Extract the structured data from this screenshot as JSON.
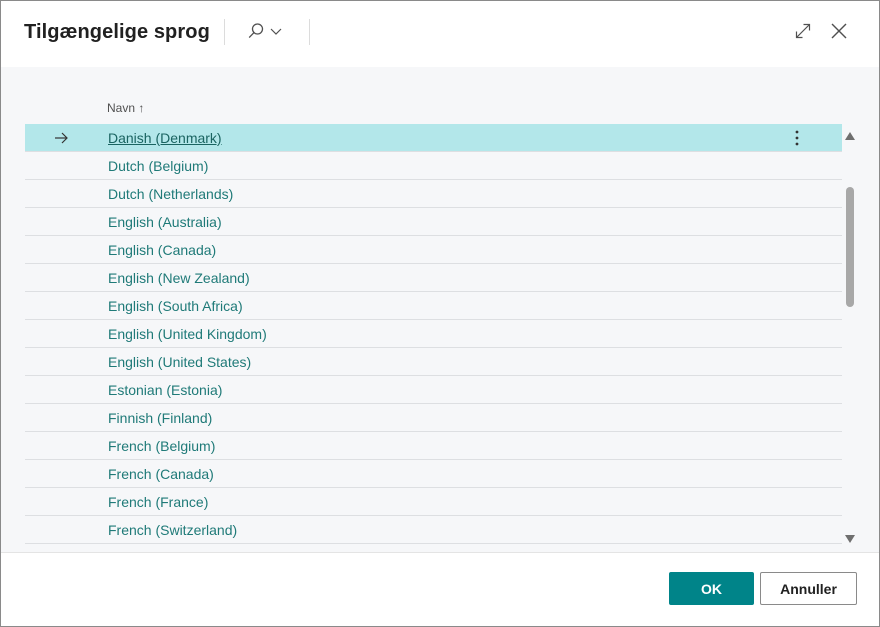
{
  "dialog": {
    "title": "Tilgængelige sprog",
    "icons": {
      "search": "search-icon",
      "dropdown": "chevron-down-icon",
      "expand": "expand-icon",
      "close": "close-icon"
    }
  },
  "list": {
    "column_header": "Navn",
    "sort_indicator": "↑",
    "selected_index": 0,
    "rows": [
      {
        "label": "Danish (Denmark)"
      },
      {
        "label": "Dutch (Belgium)"
      },
      {
        "label": "Dutch (Netherlands)"
      },
      {
        "label": "English (Australia)"
      },
      {
        "label": "English (Canada)"
      },
      {
        "label": "English (New Zealand)"
      },
      {
        "label": "English (South Africa)"
      },
      {
        "label": "English (United Kingdom)"
      },
      {
        "label": "English (United States)"
      },
      {
        "label": "Estonian (Estonia)"
      },
      {
        "label": "Finnish (Finland)"
      },
      {
        "label": "French (Belgium)"
      },
      {
        "label": "French (Canada)"
      },
      {
        "label": "French (France)"
      },
      {
        "label": "French (Switzerland)"
      },
      {
        "label": ""
      }
    ]
  },
  "footer": {
    "ok_label": "OK",
    "cancel_label": "Annuller"
  },
  "colors": {
    "accent": "#008489",
    "selected_row": "#b3e7ea",
    "link_text": "#1f7a78"
  }
}
